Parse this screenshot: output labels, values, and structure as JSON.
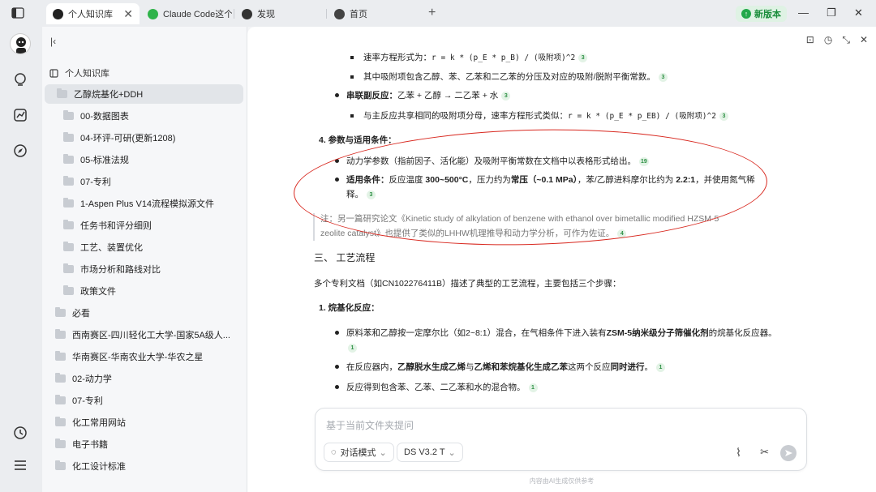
{
  "tabs": [
    {
      "label": "个人知识库",
      "close": "✕",
      "icon": "globe-icon"
    },
    {
      "label": "Claude Code这个",
      "icon": "wechat-icon"
    },
    {
      "label": "发现",
      "icon": "compass-icon"
    },
    {
      "label": "首页",
      "icon": "home-icon"
    }
  ],
  "new_tab": "+",
  "update_label": "新版本",
  "window": {
    "min": "—",
    "max": "❐",
    "close": "✕"
  },
  "sidebar": {
    "root_label": "个人知识库",
    "items": [
      {
        "label": "乙醇烷基化+DDH",
        "selected": true
      },
      {
        "label": "00-数据图表"
      },
      {
        "label": "04-环评-可研(更新1208)"
      },
      {
        "label": "05-标准法规"
      },
      {
        "label": "07-专利"
      },
      {
        "label": "1-Aspen Plus V14流程模拟源文件"
      },
      {
        "label": "任务书和评分细则"
      },
      {
        "label": "工艺、装置优化"
      },
      {
        "label": "市场分析和路线对比"
      },
      {
        "label": "政策文件"
      },
      {
        "label": "必看"
      },
      {
        "label": "西南赛区-四川轻化工大学-国家5A级人..."
      },
      {
        "label": "华南赛区-华南农业大学-华农之星"
      },
      {
        "label": "02-动力学"
      },
      {
        "label": "07-专利"
      },
      {
        "label": "化工常用网站"
      },
      {
        "label": "电子书籍"
      },
      {
        "label": "化工设计标准"
      }
    ]
  },
  "content": {
    "l1_pre": "速率方程形式为：",
    "l1_code": "r = k * (p_E * p_B) / (吸附项)^2",
    "l1_cite": "3",
    "l2": "其中吸附项包含乙醇、苯、乙苯和二乙苯的分压及对应的吸附/脱附平衡常数。",
    "l2_cite": "3",
    "l3_bold": "串联副反应：",
    "l3_text": "乙苯 + 乙醇 → 二乙苯 + 水",
    "l3_cite": "3",
    "l4_pre": "与主反应共享相同的吸附项分母，速率方程形式类似：",
    "l4_code": "r = k * (p_E * p_EB) / (吸附项)^2",
    "l4_cite": "3",
    "h4": "4. 参数与适用条件：",
    "l5": "动力学参数（指前因子、活化能）及吸附平衡常数在文档中以表格形式给出。",
    "l5_cite": "19",
    "l6_bold": "适用条件：",
    "l6_a": "反应温度",
    "l6_b": "300~500°C",
    "l6_c": "，压力约为",
    "l6_d": "常压（~0.1 MPa）",
    "l6_e": "，苯/乙醇进料摩尔比约为",
    "l6_f": "2.2:1",
    "l6_g": "，并使用氮气稀",
    "l6_h": "释。",
    "l6_cite": "3",
    "note1": "注：另一篇研究论文《Kinetic study of alkylation of benzene with ethanol over bimetallic modified HZSM-5",
    "note2": "zeolite catalyst》也提供了类似的LHHW机理推导和动力学分析，可作为佐证。",
    "note_cite": "4",
    "sec3": "三、 工艺流程",
    "p1": "多个专利文档（如CN102276411B）描述了典型的工艺流程，主要包括三个步骤：",
    "h5": "1. 烷基化反应：",
    "r1_a": "原料苯和乙醇按一定摩尔比（如2~8:1）混合，在气相条件下进入装有",
    "r1_b": "ZSM-5纳米级分子筛催化剂",
    "r1_c": "的烷基化反应器。",
    "r1_cite": "1",
    "r2_a": "在反应器内，",
    "r2_b": "乙醇脱水生成乙烯",
    "r2_c": "与",
    "r2_d": "乙烯和苯烷基化生成乙苯",
    "r2_e": "这两个反应",
    "r2_f": "同时进行",
    "r2_g": "。",
    "r2_cite": "1",
    "r3": "反应得到包含苯、乙苯、二乙苯和水的混合物。",
    "r3_cite": "1"
  },
  "input": {
    "placeholder": "基于当前文件夹提问",
    "mode": "对话模式",
    "model": "DS V3.2 T"
  },
  "footer": "内容由AI生成仅供参考",
  "colors": {
    "accent_green": "#22a84a",
    "annotation_red": "#d8281f"
  }
}
